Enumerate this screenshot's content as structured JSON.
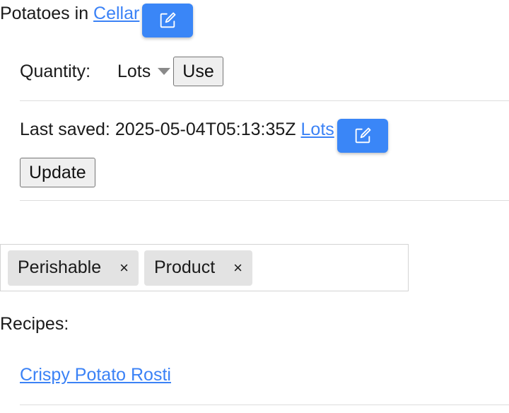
{
  "header": {
    "item_name": "Potatoes",
    "in_word": " in ",
    "location_link": "Cellar"
  },
  "quantity": {
    "label": "Quantity:",
    "selected": "Lots",
    "use_button": "Use"
  },
  "saved": {
    "label": "Last saved:",
    "timestamp": "2025-05-04T05:13:35Z",
    "value_link": "Lots",
    "update_button": "Update"
  },
  "tags": [
    {
      "label": "Perishable",
      "remove": "×"
    },
    {
      "label": "Product",
      "remove": "×"
    }
  ],
  "recipes": {
    "label": "Recipes:",
    "items": [
      {
        "label": "Crispy Potato Rosti"
      }
    ]
  },
  "colors": {
    "accent": "#3a86f7",
    "link": "#3b82f6",
    "tag_bg": "#e3e3e3"
  },
  "icons": {
    "edit": "edit-icon",
    "dropdown": "caret-down-icon",
    "remove": "close-icon"
  }
}
